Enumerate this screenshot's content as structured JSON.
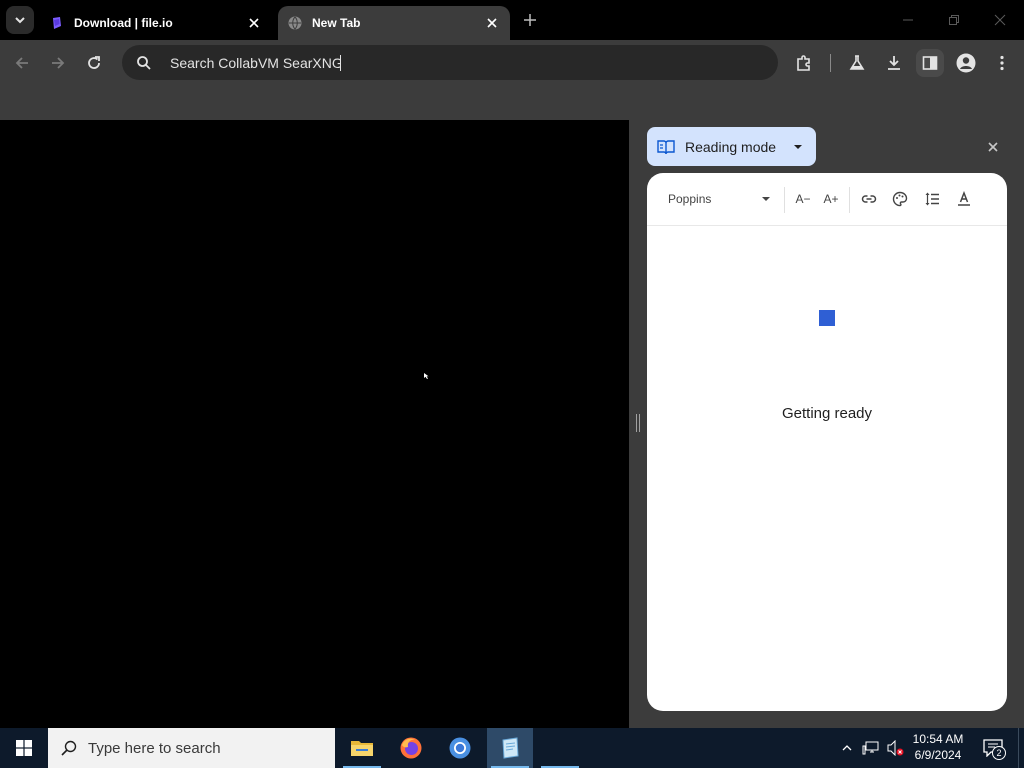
{
  "browser": {
    "tabs": [
      {
        "title": "Download | file.io",
        "active": false,
        "favicon": "file-io-icon"
      },
      {
        "title": "New Tab",
        "active": true,
        "favicon": "globe-icon"
      }
    ],
    "omnibox": {
      "placeholder": "Search CollabVM SearXNG",
      "value": ""
    }
  },
  "side_panel": {
    "selector_label": "Reading mode",
    "font_name": "Poppins",
    "status": "Getting ready",
    "tools": {
      "decrease_font": "A−",
      "increase_font": "A+"
    }
  },
  "taskbar": {
    "search_placeholder": "Type here to search",
    "apps": [
      "file-explorer",
      "firefox",
      "chrome",
      "notepad"
    ],
    "time": "10:54 AM",
    "date": "6/9/2024",
    "notification_count": "2"
  },
  "colors": {
    "accent_selector": "#d3e3fd",
    "spinner": "#2f5fd4",
    "toolbar_bg": "#3c3c3c",
    "taskbar_bg": "#0d1a2b"
  }
}
